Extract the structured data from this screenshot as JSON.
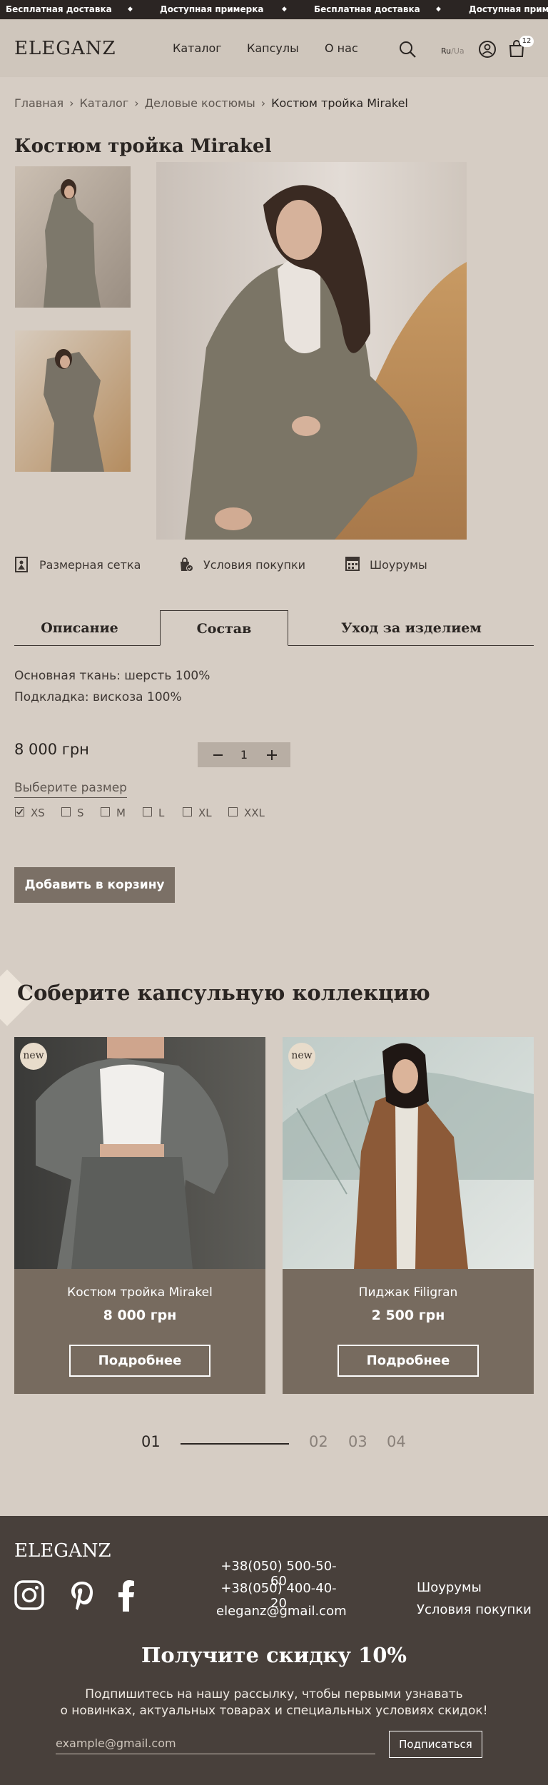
{
  "ticker": {
    "items": [
      "Бесплатная доставка",
      "Доступная примерка",
      "Бесплатная доставка",
      "Доступная приме"
    ]
  },
  "header": {
    "logo": "ELEGANZ",
    "nav": [
      "Каталог",
      "Капсулы",
      "О нас"
    ],
    "lang_active": "Ru",
    "lang_sep": "/",
    "lang_inactive": "Ua",
    "cart_count": "12"
  },
  "breadcrumb": [
    "Главная",
    "Каталог",
    "Деловые костюмы",
    "Костюм тройка Mirakel"
  ],
  "product": {
    "title": "Костюм тройка Mirakel",
    "info_links": [
      "Размерная сетка",
      "Условия покупки",
      "Шоурумы"
    ],
    "tabs": [
      "Описание",
      "Состав",
      "Уход за изделием"
    ],
    "active_tab": "Состав",
    "composition": [
      "Основная ткань: шерсть 100%",
      "Подкладка: вискоза 100%"
    ],
    "price": "8 000 грн",
    "quantity": "1",
    "size_label": "Выберите размер",
    "sizes": [
      {
        "label": "XS",
        "checked": true
      },
      {
        "label": "S",
        "checked": false
      },
      {
        "label": "M",
        "checked": false
      },
      {
        "label": "L",
        "checked": false
      },
      {
        "label": "XL",
        "checked": false
      },
      {
        "label": "XXL",
        "checked": false
      }
    ],
    "add_to_cart": "Добавить в корзину"
  },
  "capsule": {
    "title": "Соберите капсульную коллекцию",
    "cards": [
      {
        "badge": "new",
        "name": "Костюм тройка Mirakel",
        "price": "8 000 грн",
        "button": "Подробнее"
      },
      {
        "badge": "new",
        "name": "Пиджак Filigran",
        "price": "2 500 грн",
        "button": "Подробнее"
      }
    ],
    "pager": [
      "01",
      "02",
      "03",
      "04"
    ]
  },
  "footer": {
    "logo": "ELEGANZ",
    "phones": [
      "+38(050) 500-50-60",
      "+38(050) 400-40-20"
    ],
    "email": "eleganz@gmail.com",
    "links": [
      "Шоурумы",
      "Условия покупки"
    ],
    "promo_title": "Получите скидку 10%",
    "promo_text_1": "Подпишитесь на нашу рассылку, чтобы первыми узнавать",
    "promo_text_2": "о новинках, актуальных товарах и специальных условиях скидок!",
    "email_placeholder": "example@gmail.com",
    "subscribe": "Подписаться"
  },
  "colors": {
    "background": "#d6cdc4",
    "header": "#cfc6bc",
    "ticker": "#2b2523",
    "card": "#776b5f",
    "button": "#7b7066",
    "footer": "#48403b"
  }
}
